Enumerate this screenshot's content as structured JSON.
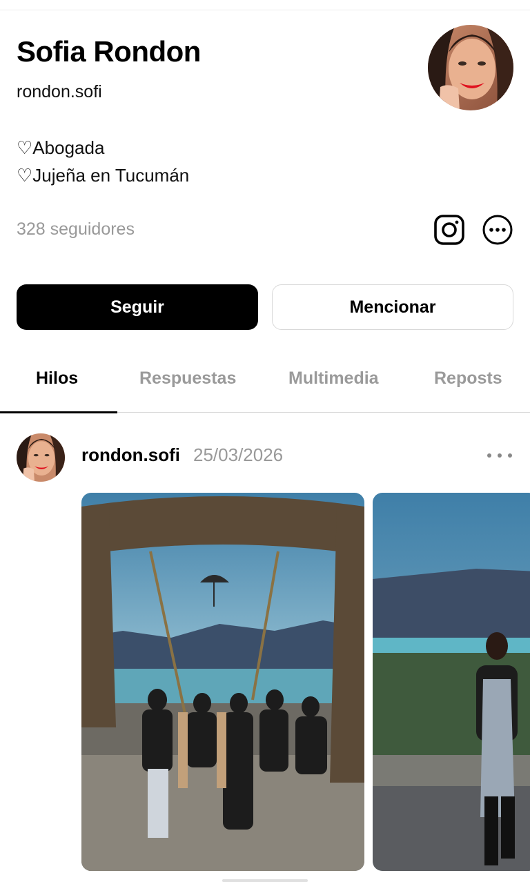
{
  "profile": {
    "name": "Sofia Rondon",
    "handle": "rondon.sofi",
    "bio": [
      "♡Abogada",
      "♡Jujeña en Tucumán"
    ],
    "followers": "328 seguidores"
  },
  "icons": {
    "instagram": "instagram-icon",
    "more": "more-options-icon",
    "post_more": "ellipsis-icon"
  },
  "actions": {
    "follow_label": "Seguir",
    "mention_label": "Mencionar"
  },
  "tabs": [
    {
      "label": "Hilos",
      "active": true
    },
    {
      "label": "Respuestas",
      "active": false
    },
    {
      "label": "Multimedia",
      "active": false
    },
    {
      "label": "Reposts",
      "active": false
    }
  ],
  "post": {
    "username": "rondon.sofi",
    "date": "25/03/2026",
    "media_count": 2
  },
  "colors": {
    "primary": "#000000",
    "muted": "#999999",
    "border": "#d9d9d9",
    "background": "#ffffff"
  }
}
